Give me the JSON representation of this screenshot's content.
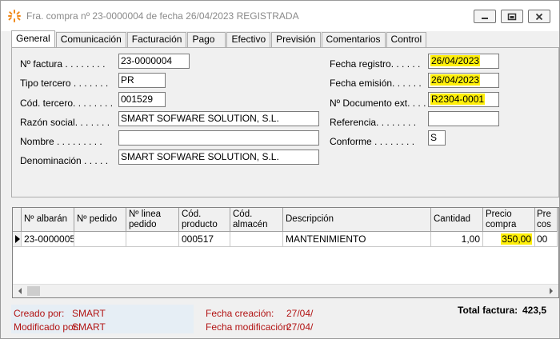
{
  "window": {
    "title": "Fra. compra nº 23-0000004 de fecha 26/04/2023 REGISTRADA",
    "minimize_label": "minimize",
    "maximize_label": "maximize",
    "close_label": "close"
  },
  "tabs": [
    {
      "label": "General"
    },
    {
      "label": "Comunicación"
    },
    {
      "label": "Facturación"
    },
    {
      "label": "Pago"
    },
    {
      "label": "Efectivo"
    },
    {
      "label": "Previsión"
    },
    {
      "label": "Comentarios"
    },
    {
      "label": "Control"
    }
  ],
  "form": {
    "n_factura": {
      "label": "Nº factura . . . . . . . .",
      "value": "23-0000004"
    },
    "tipo_tercero": {
      "label": "Tipo tercero . . . . . . .",
      "value": "PR"
    },
    "cod_tercero": {
      "label": "Cód. tercero. . . . . . . .",
      "value": "001529"
    },
    "razon_social": {
      "label": "Razón social. . . . . . .",
      "value": "SMART SOFWARE SOLUTION, S.L."
    },
    "nombre": {
      "label": "Nombre . . . . . . . . .",
      "value": ""
    },
    "denominacion": {
      "label": "Denominación . . . . .",
      "value": "SMART SOFWARE SOLUTION, S.L."
    },
    "fecha_registro": {
      "label": "Fecha registro. . . . . .",
      "value": "26/04/2023"
    },
    "fecha_emision": {
      "label": "Fecha emisión. . . . . .",
      "value": "26/04/2023"
    },
    "n_documento_ext": {
      "label": "Nº Documento ext. . . . .",
      "value": "R2304-0001"
    },
    "referencia": {
      "label": "Referencia. . . . . . . .",
      "value": ""
    },
    "conforme": {
      "label": "Conforme . . . . . . . .",
      "value": "S"
    }
  },
  "grid": {
    "headers": [
      "Nº albarán",
      "Nº pedido",
      "Nº linea pedido",
      "Cód. producto",
      "Cód. almacén",
      "Descripción",
      "Cantidad",
      "Precio compra",
      "Pre cos"
    ],
    "rows": [
      {
        "n_albaran": "23-0000005",
        "n_pedido": "",
        "n_linea_pedido": "",
        "cod_producto": "000517",
        "cod_almacen": "",
        "descripcion": "MANTENIMIENTO",
        "cantidad": "1,00",
        "precio_compra": "350,00",
        "pre_cos": "00"
      }
    ]
  },
  "footer": {
    "creado_por_label": "Creado por:",
    "creado_por_value": "SMART",
    "modificado_por_label": "Modificado por:",
    "modificado_por_value": "SMART",
    "fecha_creacion_label": "Fecha creación:",
    "fecha_creacion_value": "27/04/",
    "fecha_modificacion_label": "Fecha modificación:",
    "fecha_modificacion_value": "27/04/",
    "total_factura_label": "Total factura:",
    "total_factura_value": "423,5"
  },
  "colors": {
    "highlight": "#ffef0a",
    "footer_text": "#b21414",
    "icon_orange": "#f08a1c"
  }
}
